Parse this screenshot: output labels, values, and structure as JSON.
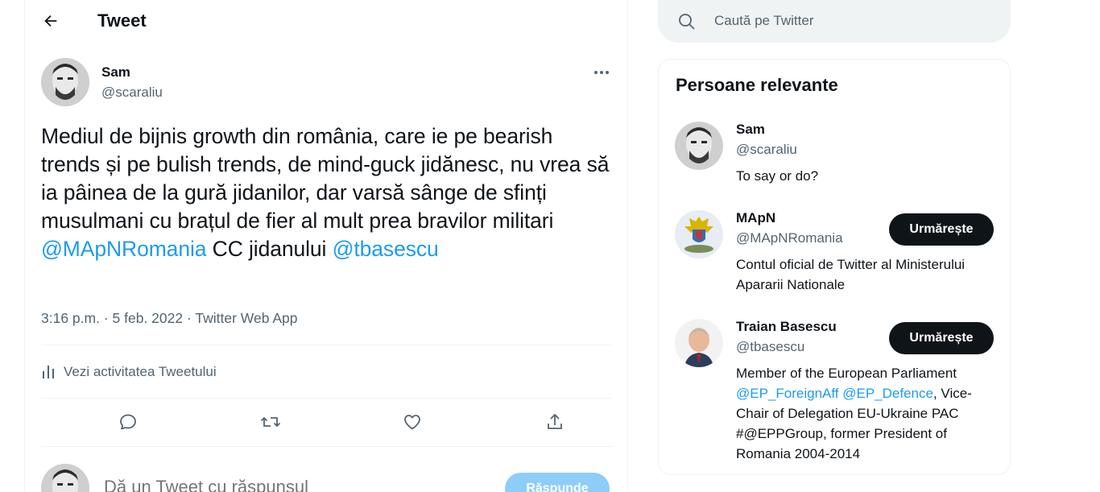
{
  "header": {
    "title": "Tweet",
    "back_icon": "arrow-left-icon"
  },
  "tweet": {
    "author_name": "Sam",
    "author_handle": "@scaraliu",
    "text_before": "Mediul de bijnis growth din românia, care ie pe bearish trends și pe bulish trends, de mind-guck jidănesc, nu vrea să ia pâinea de la gură jidanilor, dar varsă sânge de sfinți musulmani cu brațul de fier al mult prea bravilor militari ",
    "mention_1": "@MApNRomania",
    "text_middle": " CC jidanului ",
    "mention_2": "@tbasescu",
    "time": "3:16 p.m.",
    "date": "5 feb. 2022",
    "source": "Twitter Web App",
    "separator": " · ",
    "activity_label": "Vezi activitatea Tweetului"
  },
  "actions": [
    {
      "name": "reply",
      "icon": "reply-icon"
    },
    {
      "name": "retweet",
      "icon": "retweet-icon"
    },
    {
      "name": "like",
      "icon": "heart-icon"
    },
    {
      "name": "share",
      "icon": "share-icon"
    }
  ],
  "reply_box": {
    "placeholder": "Dă un Tweet cu răspunsul",
    "button_label": "Răspunde"
  },
  "search": {
    "placeholder": "Caută pe Twitter"
  },
  "sidebar": {
    "title": "Persoane relevante",
    "people": [
      {
        "name": "Sam",
        "handle": "@scaraliu",
        "bio": "To say or do?"
      },
      {
        "name": "MApN",
        "handle": "@MApNRomania",
        "bio": "Contul oficial de Twitter al Ministerului Apararii Nationale",
        "follow_label": "Urmărește"
      },
      {
        "name": "Traian Basescu",
        "handle": "@tbasescu",
        "bio_mention_1": "@EP_ForeignAff",
        "bio_mention_2": "@EP_Defence",
        "bio_start": "Member of the European Parliament ",
        "bio_space": " ",
        "bio_end": ", Vice-Chair of Delegation EU-Ukraine PAC #@EPPGroup, former President of Romania 2004-2014",
        "follow_label": "Urmărește"
      }
    ]
  },
  "colors": {
    "accent": "#1d9bf0",
    "text": "#0f1419",
    "muted": "#536471",
    "button_dark": "#0f1419",
    "button_disabled": "#8ecdf8"
  }
}
